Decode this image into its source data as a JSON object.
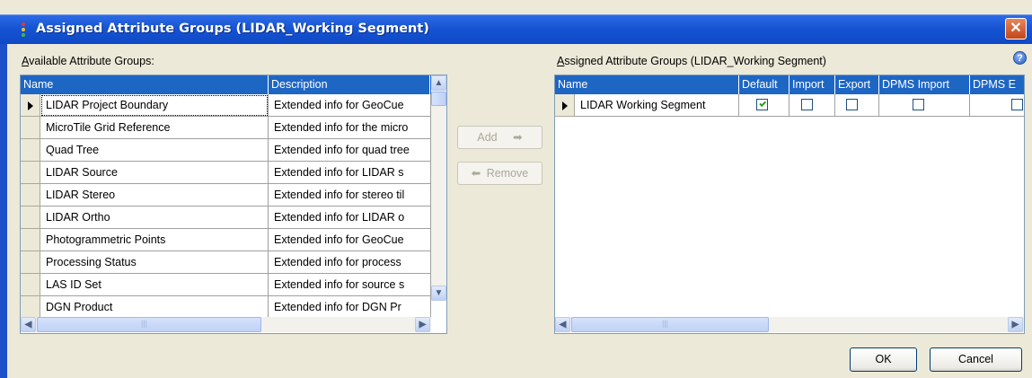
{
  "window": {
    "title": "Assigned Attribute Groups  (LIDAR_Working Segment)",
    "close_glyph": "✕",
    "accent": "#1E66C4"
  },
  "available": {
    "label_first": "A",
    "label_rest": "vailable Attribute Groups:",
    "columns": [
      "Name",
      "Description"
    ],
    "rows": [
      {
        "name": "LIDAR Project Boundary",
        "desc": "Extended info for GeoCue"
      },
      {
        "name": "MicroTile Grid Reference",
        "desc": "Extended info for the micro"
      },
      {
        "name": "Quad Tree",
        "desc": "Extended info for quad tree"
      },
      {
        "name": "LIDAR Source",
        "desc": "Extended info for LIDAR s"
      },
      {
        "name": "LIDAR Stereo",
        "desc": "Extended info for stereo til"
      },
      {
        "name": "LIDAR Ortho",
        "desc": "Extended info for LIDAR o"
      },
      {
        "name": "Photogrammetric Points",
        "desc": "Extended info for GeoCue"
      },
      {
        "name": "Processing Status",
        "desc": "Extended info for process"
      },
      {
        "name": "LAS ID Set",
        "desc": "Extended info for source s"
      },
      {
        "name": "DGN Product",
        "desc": "Extended info for DGN Pr"
      }
    ]
  },
  "buttons": {
    "add": "Add",
    "remove": "Remove",
    "ok": "OK",
    "cancel": "Cancel"
  },
  "assigned": {
    "label_first": "A",
    "label_rest": "ssigned Attribute Groups  (LIDAR_Working Segment)",
    "columns": [
      "Name",
      "Default",
      "Import",
      "Export",
      "DPMS Import",
      "DPMS E"
    ],
    "rows": [
      {
        "name": "LIDAR Working Segment",
        "default": true,
        "import": false,
        "export": false,
        "dpms_import": false,
        "dpms_export": false
      }
    ]
  },
  "icons": {
    "help": "?",
    "scroll_up": "▲",
    "scroll_down": "▼",
    "scroll_left": "◀",
    "scroll_right": "▶",
    "grip": "|||"
  }
}
